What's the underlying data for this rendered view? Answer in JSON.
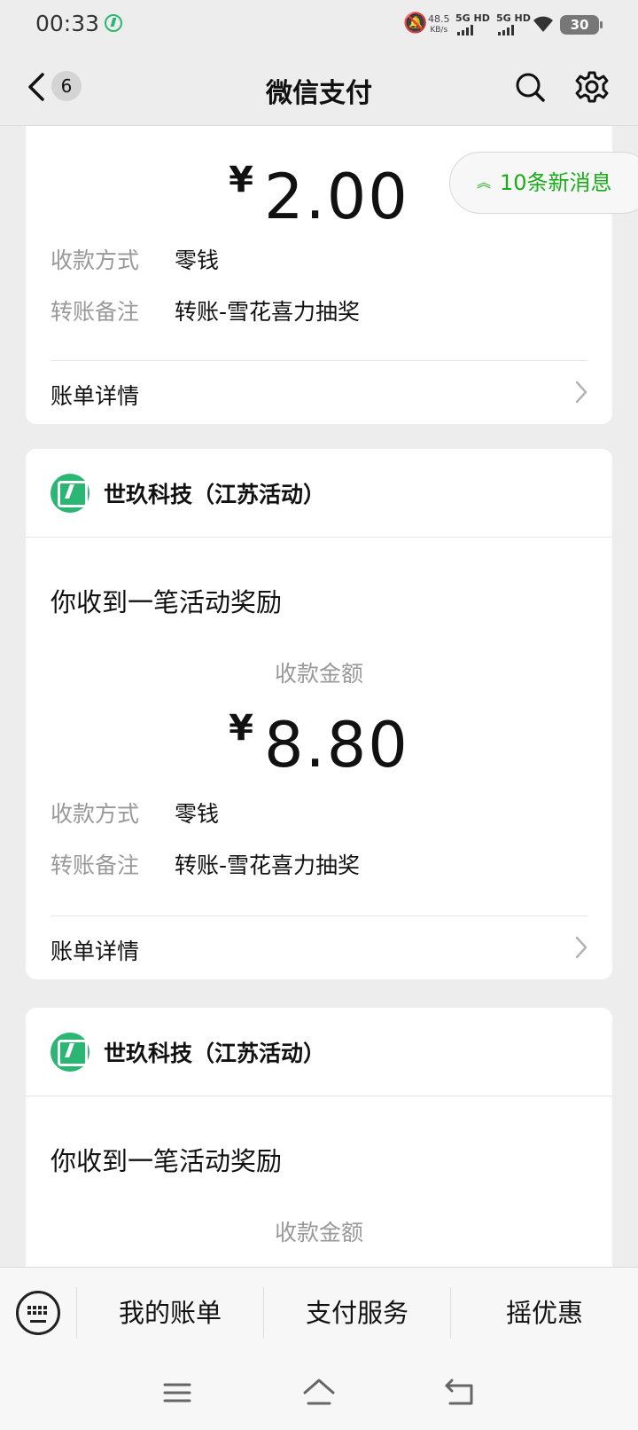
{
  "status_bar": {
    "time": "00:33",
    "speed_value": "48.5",
    "speed_unit": "KB/s",
    "net1": "5G HD",
    "net2": "5G HD",
    "battery": "30"
  },
  "header": {
    "title": "微信支付",
    "unread_count": "6"
  },
  "new_messages": "10条新消息",
  "cards": [
    {
      "amount_currency": "¥",
      "amount_value": "2.00",
      "method_label": "收款方式",
      "method_value": "零钱",
      "remark_label": "转账备注",
      "remark_value": "转账-雪花喜力抽奖",
      "detail_label": "账单详情"
    },
    {
      "merchant": "世玖科技（江苏活动）",
      "notice": "你收到一笔活动奖励",
      "amount_label": "收款金额",
      "amount_currency": "¥",
      "amount_value": "8.80",
      "method_label": "收款方式",
      "method_value": "零钱",
      "remark_label": "转账备注",
      "remark_value": "转账-雪花喜力抽奖",
      "detail_label": "账单详情"
    },
    {
      "merchant": "世玖科技（江苏活动）",
      "notice": "你收到一笔活动奖励",
      "amount_label": "收款金额"
    }
  ],
  "bottom_menu": {
    "items": [
      "我的账单",
      "支付服务",
      "摇优惠"
    ]
  },
  "icons": {
    "accent": "#1aad19",
    "logo_color": "#2bb673"
  }
}
